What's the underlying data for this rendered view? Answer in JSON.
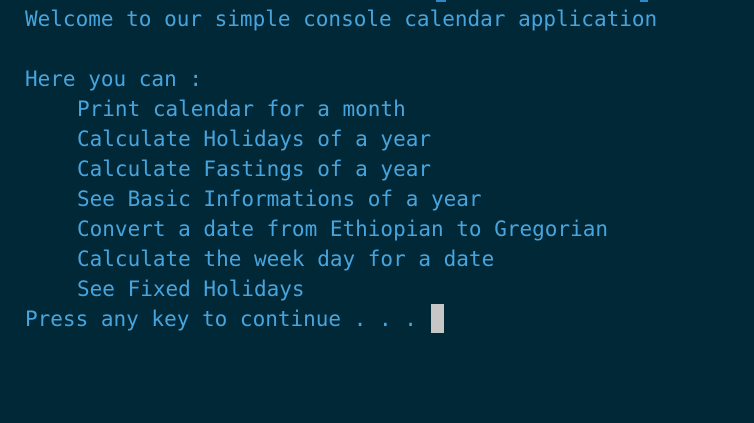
{
  "colors": {
    "background": "#002837",
    "text": "#47a4dd",
    "cursor": "#c6c6c6"
  },
  "console": {
    "welcome": "Welcome to our simple console calendar application",
    "intro": "Here you can :",
    "menu_items": [
      "Print calendar for a month",
      "Calculate Holidays of a year",
      "Calculate Fastings of a year",
      "See Basic Informations of a year",
      "Convert a date from Ethiopian to Gregorian",
      "Calculate the week day for a date",
      "See Fixed Holidays"
    ],
    "prompt": "Press any key to continue . . . "
  }
}
